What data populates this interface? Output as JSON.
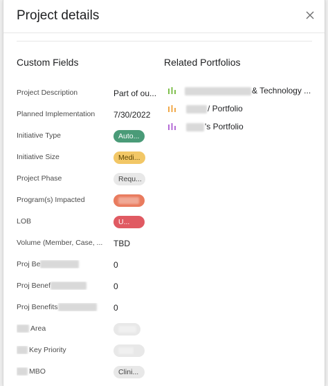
{
  "dialog": {
    "title": "Project details",
    "close_icon": "close-icon"
  },
  "custom_fields": {
    "heading": "Custom Fields",
    "rows": [
      {
        "label": "Project Description",
        "value": "Part of ou...",
        "kind": "text"
      },
      {
        "label": "Planned Implementation",
        "value": "7/30/2022",
        "kind": "text"
      },
      {
        "label": "Initiative Type",
        "value": "Auto...",
        "kind": "pill",
        "bg": "#4a9b78",
        "fg": "#ffffff"
      },
      {
        "label": "Initiative Size",
        "value": "Medi...",
        "kind": "pill",
        "bg": "#f2c766",
        "fg": "#5a4300"
      },
      {
        "label": "Project Phase",
        "value": "Requ...",
        "kind": "pill",
        "bg": "#e8e8e8",
        "fg": "#444444"
      },
      {
        "label": "Program(s) Impacted",
        "value": "",
        "kind": "pill",
        "bg": "#e97b5e",
        "fg": "#ffffff"
      },
      {
        "label": "LOB",
        "value": "U...",
        "kind": "pill",
        "bg": "#e05a62",
        "fg": "#ffffff"
      },
      {
        "label": "Volume (Member, Case, ...",
        "value": "TBD",
        "kind": "text"
      },
      {
        "label": "Proj Be",
        "value": "0",
        "kind": "text"
      },
      {
        "label": "Proj Benef",
        "value": "0",
        "kind": "text"
      },
      {
        "label": "Proj Benefits",
        "value": "0",
        "kind": "text"
      },
      {
        "label": "Area",
        "value": "",
        "kind": "pill",
        "bg": "#e8e8e8",
        "fg": "#444444"
      },
      {
        "label": "Key Priority",
        "value": "",
        "kind": "pill",
        "bg": "#e8e8e8",
        "fg": "#444444"
      },
      {
        "label": "MBO",
        "value": "Clini...",
        "kind": "pill",
        "bg": "#e8e8e8",
        "fg": "#444444"
      }
    ]
  },
  "related_portfolios": {
    "heading": "Related Portfolios",
    "items": [
      {
        "name": "& Technology ...",
        "icon": "portfolio-chart-icon",
        "color": "#7fbf4d"
      },
      {
        "name": "/ Portfolio",
        "icon": "portfolio-chart-icon",
        "color": "#f0a848"
      },
      {
        "name": "'s Portfolio",
        "icon": "portfolio-chart-icon",
        "color": "#b46bd6"
      }
    ]
  }
}
